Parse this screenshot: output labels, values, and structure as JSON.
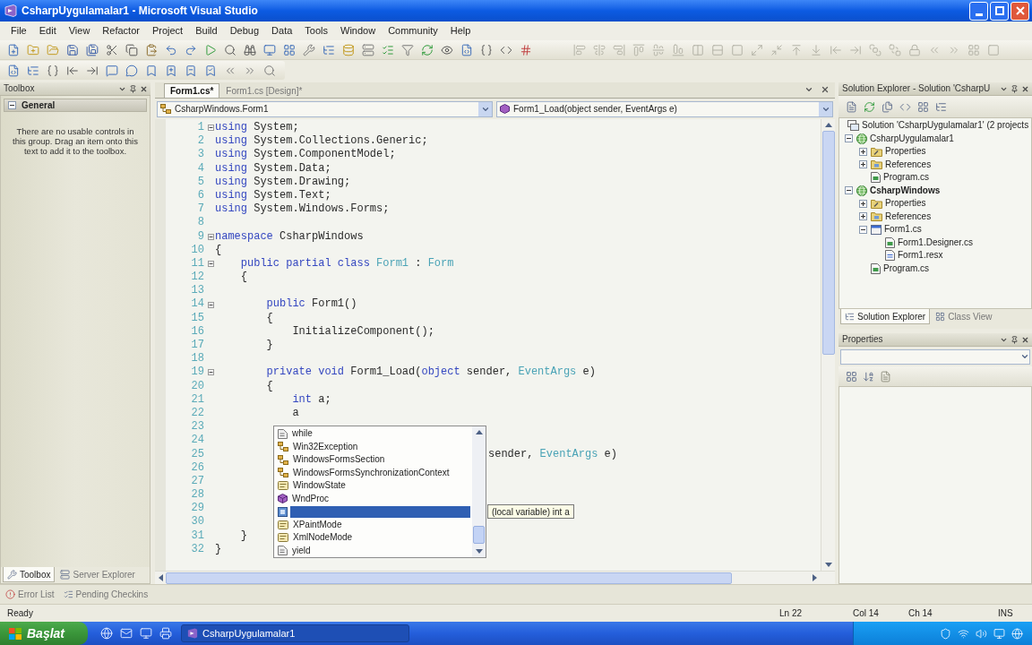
{
  "window": {
    "title": "CsharpUygulamalar1 - Microsoft Visual Studio"
  },
  "menu": [
    "File",
    "Edit",
    "View",
    "Refactor",
    "Project",
    "Build",
    "Debug",
    "Data",
    "Tools",
    "Window",
    "Community",
    "Help"
  ],
  "toolbox": {
    "title": "Toolbox",
    "group": {
      "label": "General",
      "expanded": true
    },
    "message": "There are no usable controls in this group. Drag an item onto this text to add it to the toolbox.",
    "tabs": [
      {
        "label": "Toolbox",
        "selected": true
      },
      {
        "label": "Server Explorer",
        "selected": false
      }
    ]
  },
  "editor": {
    "tabs": [
      {
        "label": "Form1.cs*",
        "selected": true
      },
      {
        "label": "Form1.cs [Design]*",
        "selected": false
      }
    ],
    "type_combo": "CsharpWindows.Form1",
    "member_combo": "Form1_Load(object sender, EventArgs e)",
    "lines": [
      {
        "number": "1",
        "kind": "code",
        "fold": true,
        "tokens": [
          {
            "kind": "keyword",
            "text": "using"
          },
          {
            "kind": "plain",
            "text": " System;"
          }
        ]
      },
      {
        "number": "2",
        "kind": "code",
        "fold": false,
        "tokens": [
          {
            "kind": "keyword",
            "text": "using"
          },
          {
            "kind": "plain",
            "text": " System.Collections.Generic;"
          }
        ]
      },
      {
        "number": "3",
        "kind": "code",
        "fold": false,
        "tokens": [
          {
            "kind": "keyword",
            "text": "using"
          },
          {
            "kind": "plain",
            "text": " System.ComponentModel;"
          }
        ]
      },
      {
        "number": "4",
        "kind": "code",
        "fold": false,
        "tokens": [
          {
            "kind": "keyword",
            "text": "using"
          },
          {
            "kind": "plain",
            "text": " System.Data;"
          }
        ]
      },
      {
        "number": "5",
        "kind": "code",
        "fold": false,
        "tokens": [
          {
            "kind": "keyword",
            "text": "using"
          },
          {
            "kind": "plain",
            "text": " System.Drawing;"
          }
        ]
      },
      {
        "number": "6",
        "kind": "code",
        "fold": false,
        "tokens": [
          {
            "kind": "keyword",
            "text": "using"
          },
          {
            "kind": "plain",
            "text": " System.Text;"
          }
        ]
      },
      {
        "number": "7",
        "kind": "code",
        "fold": false,
        "tokens": [
          {
            "kind": "keyword",
            "text": "using"
          },
          {
            "kind": "plain",
            "text": " System.Windows.Forms;"
          }
        ]
      },
      {
        "number": "8",
        "kind": "code",
        "fold": false
      },
      {
        "number": "9",
        "kind": "code",
        "fold": true,
        "tokens": [
          {
            "kind": "keyword",
            "text": "namespace"
          },
          {
            "kind": "plain",
            "text": " CsharpWindows"
          }
        ]
      },
      {
        "number": "10",
        "kind": "code",
        "fold": false,
        "tokens": [
          {
            "kind": "plain",
            "text": "{"
          }
        ]
      },
      {
        "number": "11",
        "kind": "code",
        "fold": true,
        "tokens": [
          {
            "kind": "keyword",
            "text": "    public partial class "
          },
          {
            "kind": "type",
            "text": "Form1"
          },
          {
            "kind": "plain",
            "text": " : "
          },
          {
            "kind": "type",
            "text": "Form"
          }
        ]
      },
      {
        "number": "12",
        "kind": "code",
        "fold": false,
        "tokens": [
          {
            "kind": "plain",
            "text": "    {"
          }
        ]
      },
      {
        "number": "13",
        "kind": "code",
        "fold": false
      },
      {
        "number": "14",
        "kind": "code",
        "fold": true,
        "tokens": [
          {
            "kind": "keyword",
            "text": "        public"
          },
          {
            "kind": "plain",
            "text": " Form1()"
          }
        ]
      },
      {
        "number": "15",
        "kind": "code",
        "fold": false,
        "tokens": [
          {
            "kind": "plain",
            "text": "        {"
          }
        ]
      },
      {
        "number": "16",
        "kind": "code",
        "fold": false,
        "tokens": [
          {
            "kind": "plain",
            "text": "            InitializeComponent();"
          }
        ]
      },
      {
        "number": "17",
        "kind": "code",
        "fold": false,
        "tokens": [
          {
            "kind": "plain",
            "text": "        }"
          }
        ]
      },
      {
        "number": "18",
        "kind": "code",
        "fold": false
      },
      {
        "number": "19",
        "kind": "code",
        "fold": true,
        "tokens": [
          {
            "kind": "keyword",
            "text": "        private void"
          },
          {
            "kind": "plain",
            "text": " Form1_Load("
          },
          {
            "kind": "keyword",
            "text": "object"
          },
          {
            "kind": "plain",
            "text": " sender, "
          },
          {
            "kind": "type",
            "text": "EventArgs"
          },
          {
            "kind": "plain",
            "text": " e)"
          }
        ]
      },
      {
        "number": "20",
        "kind": "code",
        "fold": false,
        "tokens": [
          {
            "kind": "plain",
            "text": "        {"
          }
        ]
      },
      {
        "number": "21",
        "kind": "code",
        "fold": false,
        "tokens": [
          {
            "kind": "keyword",
            "text": "            int"
          },
          {
            "kind": "plain",
            "text": " a;"
          }
        ]
      },
      {
        "number": "22",
        "kind": "code",
        "fold": false,
        "tokens": [
          {
            "kind": "plain",
            "text": "            a"
          }
        ]
      },
      {
        "number": "23",
        "kind": "code",
        "fold": false
      },
      {
        "number": "24",
        "kind": "code",
        "fold": false
      },
      {
        "number": "25",
        "kind": "clipped",
        "fold": false,
        "tokens": [
          {
            "kind": "plain",
            "text": "sender, "
          },
          {
            "kind": "type",
            "text": "EventArgs"
          },
          {
            "kind": "plain",
            "text": " e)"
          }
        ]
      },
      {
        "number": "26",
        "kind": "code",
        "fold": false
      },
      {
        "number": "27",
        "kind": "code",
        "fold": false
      },
      {
        "number": "28",
        "kind": "code",
        "fold": false
      },
      {
        "number": "29",
        "kind": "code",
        "fold": false
      },
      {
        "number": "30",
        "kind": "code",
        "fold": false
      },
      {
        "number": "31",
        "kind": "code",
        "fold": false,
        "tokens": [
          {
            "kind": "plain",
            "text": "    }"
          }
        ]
      },
      {
        "number": "32",
        "kind": "code",
        "fold": false,
        "tokens": [
          {
            "kind": "plain",
            "text": "}"
          }
        ]
      }
    ],
    "completion": {
      "items": [
        {
          "kind": "keyword",
          "label": "while",
          "selected": false
        },
        {
          "kind": "class",
          "label": "Win32Exception",
          "selected": false
        },
        {
          "kind": "class",
          "label": "WindowsFormsSection",
          "selected": false
        },
        {
          "kind": "class",
          "label": "WindowsFormsSynchronizationContext",
          "selected": false
        },
        {
          "kind": "property",
          "label": "WindowState",
          "selected": false
        },
        {
          "kind": "method",
          "label": "WndProc",
          "selected": false
        },
        {
          "kind": "local",
          "selected": true
        },
        {
          "kind": "property",
          "label": "XPaintMode",
          "selected": false
        },
        {
          "kind": "property",
          "label": "XmlNodeMode",
          "selected": false
        },
        {
          "kind": "keyword",
          "label": "yield",
          "selected": false
        }
      ]
    },
    "tooltip": "(local variable) int a"
  },
  "solution_explorer": {
    "title": "Solution Explorer - Solution 'CsharpU",
    "tree": [
      {
        "kind": "solution",
        "label": "Solution 'CsharpUygulamalar1' (2 projects",
        "children": [
          {
            "kind": "project",
            "label": "CsharpUygulamalar1",
            "expanded": true,
            "startup": false,
            "children": [
              {
                "kind": "properties",
                "label": "Properties",
                "expanded": false
              },
              {
                "kind": "references",
                "label": "References",
                "expanded": false
              },
              {
                "kind": "source",
                "label": "Program.cs"
              }
            ]
          },
          {
            "kind": "project",
            "label": "CsharpWindows",
            "expanded": true,
            "startup": true,
            "children": [
              {
                "kind": "properties",
                "label": "Properties",
                "expanded": false
              },
              {
                "kind": "references",
                "label": "References",
                "expanded": false
              },
              {
                "kind": "form",
                "label": "Form1.cs",
                "expanded": true,
                "children": [
                  {
                    "kind": "source",
                    "label": "Form1.Designer.cs"
                  },
                  {
                    "kind": "resource",
                    "label": "Form1.resx"
                  }
                ]
              },
              {
                "kind": "source",
                "label": "Program.cs"
              }
            ]
          }
        ]
      }
    ],
    "tabs": [
      {
        "label": "Solution Explorer",
        "selected": true
      },
      {
        "label": "Class View",
        "selected": false
      }
    ]
  },
  "properties": {
    "title": "Properties"
  },
  "autohide_tabs": [
    {
      "label": "Error List"
    },
    {
      "label": "Pending Checkins"
    }
  ],
  "status_bar": {
    "message": "Ready",
    "line": "Ln 22",
    "column": "Col 14",
    "char": "Ch 14",
    "mode": "INS"
  },
  "taskbar": {
    "start": "Başlat",
    "tasks": [
      {
        "label": "CsharpUygulamalar1",
        "selected": true
      }
    ]
  }
}
